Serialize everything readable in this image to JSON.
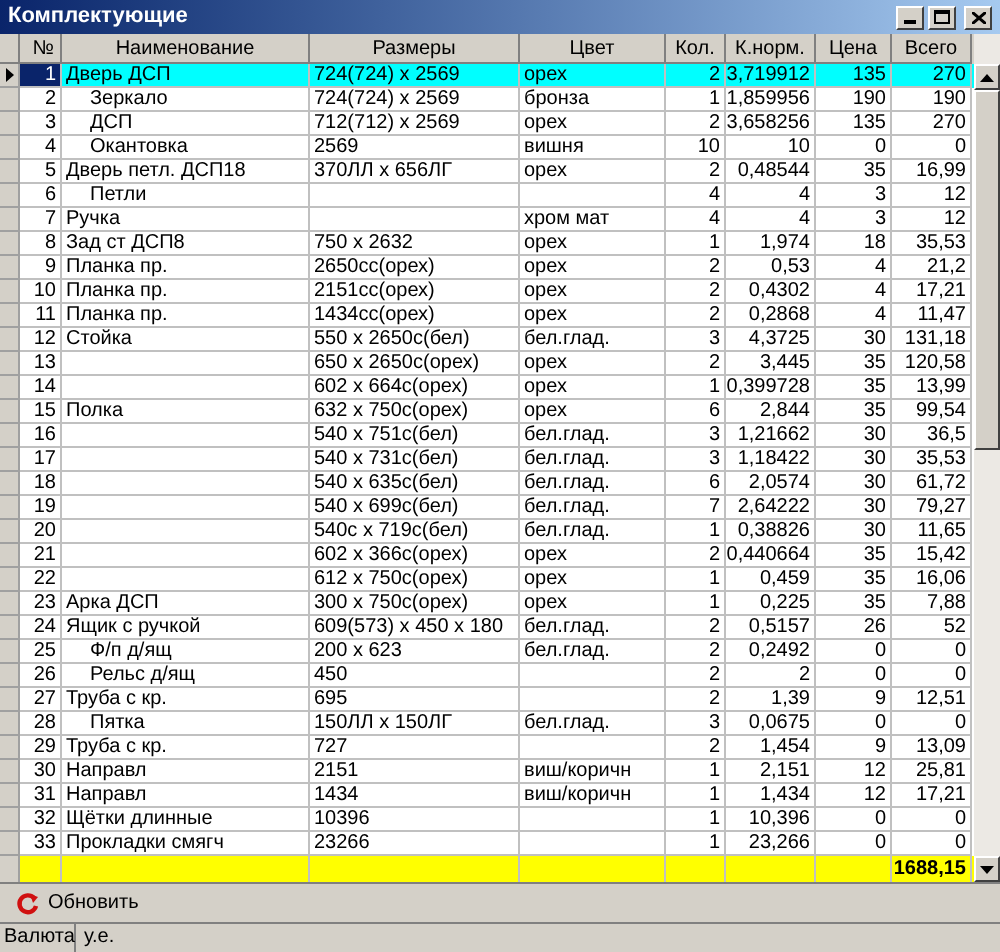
{
  "window": {
    "title": "Комплектующие"
  },
  "table": {
    "columns": [
      "№",
      "Наименование",
      "Размеры",
      "Цвет",
      "Кол.",
      "К.норм.",
      "Цена",
      "Всего"
    ],
    "rows": [
      {
        "num": "1",
        "name": "Дверь ДСП",
        "size": "724(724) x 2569",
        "finish": "орех",
        "qty": "2",
        "norm": "3,719912",
        "price": "135",
        "total": "270",
        "selected": true,
        "children": [
          {
            "num": "2",
            "name": "Зеркало",
            "size": "724(724) x 2569",
            "finish": "бронза",
            "qty": "1",
            "norm": "1,859956",
            "price": "190",
            "total": "190",
            "selected": false
          },
          {
            "num": "3",
            "name": "ДСП",
            "size": "712(712) x 2569",
            "finish": "орех",
            "qty": "2",
            "norm": "3,658256",
            "price": "135",
            "total": "270",
            "selected": false
          },
          {
            "num": "4",
            "name": "Окантовка",
            "size": "2569",
            "finish": "вишня",
            "qty": "10",
            "norm": "10",
            "price": "0",
            "total": "0",
            "selected": false
          }
        ]
      },
      {
        "num": "5",
        "name": "Дверь петл. ДСП18",
        "size": "370ЛЛ x 656ЛГ",
        "finish": "орех",
        "qty": "2",
        "norm": "0,48544",
        "price": "35",
        "total": "16,99",
        "selected": false,
        "children": [
          {
            "num": "6",
            "name": "Петли",
            "qty": "4",
            "norm": "4",
            "price": "3",
            "total": "12",
            "selected": false
          }
        ]
      },
      {
        "num": "7",
        "name": "Ручка",
        "finish": "хром мат",
        "qty": "4",
        "norm": "4",
        "price": "3",
        "total": "12",
        "selected": false
      },
      {
        "num": "8",
        "name": "Зад ст ДСП8",
        "size": "750 x 2632",
        "finish": "орех",
        "qty": "1",
        "norm": "1,974",
        "price": "18",
        "total": "35,53",
        "selected": false
      },
      {
        "num": "9",
        "name": "Планка пр.",
        "size": "2650сс(орех)",
        "finish": "орех",
        "qty": "2",
        "norm": "0,53",
        "price": "4",
        "total": "21,2",
        "selected": false
      },
      {
        "num": "10",
        "name": "Планка пр.",
        "size": "2151сс(орех)",
        "finish": "орех",
        "qty": "2",
        "norm": "0,4302",
        "price": "4",
        "total": "17,21",
        "selected": false
      },
      {
        "num": "11",
        "name": "Планка пр.",
        "size": "1434сс(орех)",
        "finish": "орех",
        "qty": "2",
        "norm": "0,2868",
        "price": "4",
        "total": "11,47",
        "selected": false
      },
      {
        "num": "12",
        "name": "Стойка",
        "size": "550 x 2650с(бел)",
        "finish": "бел.глад.",
        "qty": "3",
        "norm": "4,3725",
        "price": "30",
        "total": "131,18",
        "selected": false
      },
      {
        "num": "13",
        "size": "650 x 2650с(орех)",
        "finish": "орех",
        "qty": "2",
        "norm": "3,445",
        "price": "35",
        "total": "120,58",
        "selected": false
      },
      {
        "num": "14",
        "size": "602 x 664с(орех)",
        "finish": "орех",
        "qty": "1",
        "norm": "0,399728",
        "price": "35",
        "total": "13,99",
        "selected": false
      },
      {
        "num": "15",
        "name": "Полка",
        "size": "632 x 750с(орех)",
        "finish": "орех",
        "qty": "6",
        "norm": "2,844",
        "price": "35",
        "total": "99,54",
        "selected": false
      },
      {
        "num": "16",
        "size": "540 x 751с(бел)",
        "finish": "бел.глад.",
        "qty": "3",
        "norm": "1,21662",
        "price": "30",
        "total": "36,5",
        "selected": false
      },
      {
        "num": "17",
        "size": "540 x 731с(бел)",
        "finish": "бел.глад.",
        "qty": "3",
        "norm": "1,18422",
        "price": "30",
        "total": "35,53",
        "selected": false
      },
      {
        "num": "18",
        "size": "540 x 635с(бел)",
        "finish": "бел.глад.",
        "qty": "6",
        "norm": "2,0574",
        "price": "30",
        "total": "61,72",
        "selected": false
      },
      {
        "num": "19",
        "size": "540 x 699с(бел)",
        "finish": "бел.глад.",
        "qty": "7",
        "norm": "2,64222",
        "price": "30",
        "total": "79,27",
        "selected": false
      },
      {
        "num": "20",
        "size": "540с x 719с(бел)",
        "finish": "бел.глад.",
        "qty": "1",
        "norm": "0,38826",
        "price": "30",
        "total": "11,65",
        "selected": false
      },
      {
        "num": "21",
        "size": "602 x 366с(орех)",
        "finish": "орех",
        "qty": "2",
        "norm": "0,440664",
        "price": "35",
        "total": "15,42",
        "selected": false
      },
      {
        "num": "22",
        "size": "612 x 750с(орех)",
        "finish": "орех",
        "qty": "1",
        "norm": "0,459",
        "price": "35",
        "total": "16,06",
        "selected": false
      },
      {
        "num": "23",
        "name": "Арка ДСП",
        "size": "300 x 750с(орех)",
        "finish": "орех",
        "qty": "1",
        "norm": "0,225",
        "price": "35",
        "total": "7,88",
        "selected": false
      },
      {
        "num": "24",
        "name": "Ящик с ручкой",
        "size": "609(573) x 450 x 180",
        "finish": "бел.глад.",
        "qty": "2",
        "norm": "0,5157",
        "price": "26",
        "total": "52",
        "selected": false,
        "children": [
          {
            "num": "25",
            "name": "Ф/п д/ящ",
            "size": "200 x 623",
            "finish": "бел.глад.",
            "qty": "2",
            "norm": "0,2492",
            "price": "0",
            "total": "0",
            "selected": false
          },
          {
            "num": "26",
            "name": "Рельс д/ящ",
            "size": "450",
            "qty": "2",
            "norm": "2",
            "price": "0",
            "total": "0",
            "selected": false
          }
        ]
      },
      {
        "num": "27",
        "name": "Труба с кр.",
        "size": "695",
        "qty": "2",
        "norm": "1,39",
        "price": "9",
        "total": "12,51",
        "selected": false,
        "children": [
          {
            "num": "28",
            "name": "Пятка",
            "size": "150ЛЛ x 150ЛГ",
            "finish": "бел.глад.",
            "qty": "3",
            "norm": "0,0675",
            "price": "0",
            "total": "0",
            "selected": false
          }
        ]
      },
      {
        "num": "29",
        "name": "Труба с кр.",
        "size": "727",
        "qty": "2",
        "norm": "1,454",
        "price": "9",
        "total": "13,09",
        "selected": false
      },
      {
        "num": "30",
        "name": "Направл",
        "size": "2151",
        "finish": "виш/коричн",
        "qty": "1",
        "norm": "2,151",
        "price": "12",
        "total": "25,81",
        "selected": false
      },
      {
        "num": "31",
        "name": "Направл",
        "size": "1434",
        "finish": "виш/коричн",
        "qty": "1",
        "norm": "1,434",
        "price": "12",
        "total": "17,21",
        "selected": false
      },
      {
        "num": "32",
        "name": "Щётки длинные",
        "size": "10396",
        "qty": "1",
        "norm": "10,396",
        "price": "0",
        "total": "0",
        "selected": false
      },
      {
        "num": "33",
        "name": "Прокладки смягч",
        "size": "23266",
        "qty": "1",
        "norm": "23,266",
        "price": "0",
        "total": "0",
        "selected": false
      }
    ],
    "total": "1688,15"
  },
  "refresh_button": "Обновить",
  "status_bar": {
    "label": "Валюта",
    "value": "у.е."
  }
}
